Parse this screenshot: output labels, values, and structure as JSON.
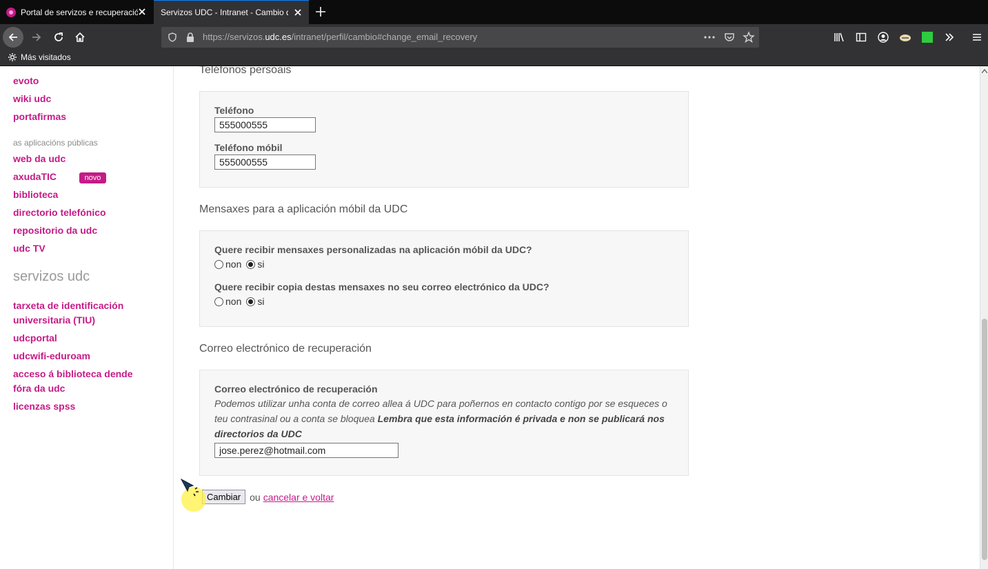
{
  "browser": {
    "tabs": [
      {
        "label": "Portal de servizos e recuperación",
        "active": false
      },
      {
        "label": "Servizos UDC - Intranet - Cambio de",
        "active": true
      }
    ],
    "url": {
      "prefix": "https://servizos.",
      "domain": "udc.es",
      "path": "/intranet/perfil/cambio#change_email_recovery"
    },
    "bookmarks": {
      "most_visited": "Más visitados"
    }
  },
  "sidebar": {
    "links_top": [
      "evoto",
      "wiki udc",
      "portafirmas"
    ],
    "section_public": "as aplicacións públicas",
    "public_links": [
      "web da udc",
      "axudaTIC",
      "biblioteca",
      "directorio telefónico",
      "repositorio da udc",
      "udc TV"
    ],
    "badge_new": "novo",
    "heading_services": "servizos udc",
    "service_links": [
      "tarxeta de identificación",
      "universitaria (TIU)",
      "udcportal",
      "udcwifi-eduroam",
      "acceso á biblioteca dende",
      "fóra da udc",
      "licenzas spss"
    ]
  },
  "phones": {
    "title": "Teléfonos persoais",
    "phone_label": "Teléfono",
    "phone_value": "555000555",
    "mobile_label": "Teléfono móbil",
    "mobile_value": "555000555"
  },
  "messages": {
    "title": "Mensaxes para a aplicación móbil da UDC",
    "q1": "Quere recibir mensaxes personalizadas na aplicación móbil da UDC?",
    "q2": "Quere recibir copia destas mensaxes no seu correo electrónico da UDC?",
    "opt_no": "non",
    "opt_yes": "si",
    "q1_selected": "si",
    "q2_selected": "si"
  },
  "recovery": {
    "title": "Correo electrónico de recuperación",
    "label": "Correo electrónico de recuperación",
    "help_italic": "Podemos utilizar unha conta de correo allea á UDC para poñernos en contacto contigo por se esqueces o teu contrasinal ou a conta se bloquea ",
    "help_bold": "Lembra que esta información é privada e non se publicará nos directorios da UDC",
    "email_value": "jose.perez@hotmail.com"
  },
  "actions": {
    "submit": "Cambiar",
    "or": "ou",
    "cancel": "cancelar e voltar"
  }
}
